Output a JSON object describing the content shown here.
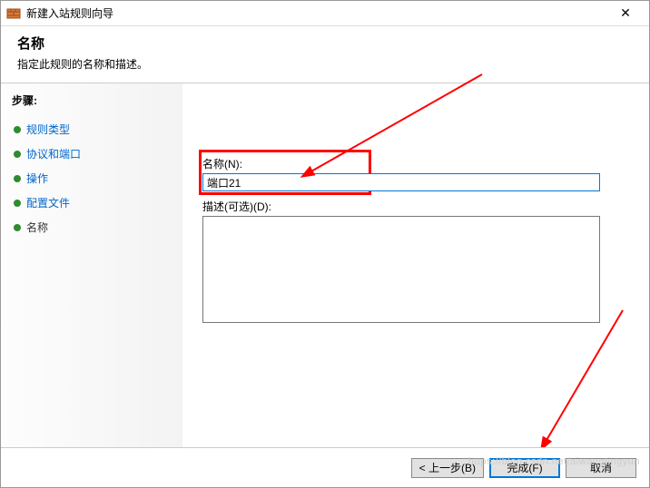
{
  "window": {
    "title": "新建入站规则向导",
    "close": "✕"
  },
  "header": {
    "title": "名称",
    "subtitle": "指定此规则的名称和描述。"
  },
  "sidebar": {
    "label": "步骤:",
    "steps": [
      {
        "label": "规则类型"
      },
      {
        "label": "协议和端口"
      },
      {
        "label": "操作"
      },
      {
        "label": "配置文件"
      },
      {
        "label": "名称"
      }
    ]
  },
  "form": {
    "name_label": "名称(N):",
    "name_value": "端口21",
    "desc_label": "描述(可选)(D):",
    "desc_value": ""
  },
  "footer": {
    "back": "< 上一步(B)",
    "finish": "完成(F)",
    "cancel": "取消"
  },
  "watermark": "https://blog.csdn.net/aiwangtingyun"
}
